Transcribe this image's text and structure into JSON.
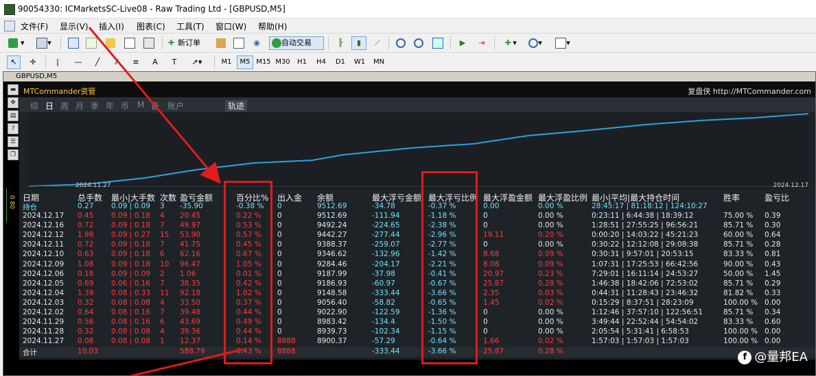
{
  "window": {
    "title": "90054330: ICMarketsSC-Live08 - Raw Trading Ltd - [GBPUSD,M5]"
  },
  "menu": [
    "文件(F)",
    "显示(V)",
    "插入(I)",
    "图表(C)",
    "工具(T)",
    "窗口(W)",
    "帮助(H)"
  ],
  "toolbar": {
    "new_order": "新订单",
    "autotrade": "自动交易",
    "timeframes": [
      "M1",
      "M5",
      "M15",
      "M30",
      "H1",
      "H4",
      "D1",
      "W1",
      "MN"
    ],
    "active_timeframe": "M5"
  },
  "chart_window": {
    "title": "GBPUSD,M5",
    "side_price": "0 80"
  },
  "panel": {
    "brand": "MTCommander资管",
    "brand_right_label": "复盘侠",
    "brand_right_url": "http://MTCommander.com",
    "tabs": [
      "综",
      "日",
      "周",
      "月",
      "季",
      "年",
      "币",
      "M",
      "备",
      "账户"
    ],
    "active_tab": "日",
    "track_tab": "轨迹",
    "graph_date_start": "2024.11.27",
    "graph_date_end": "2024.12.17"
  },
  "table": {
    "headers": [
      "日期",
      "总手数",
      "最小|大手数",
      "次数",
      "盈亏金额",
      "百分比%",
      "出入金",
      "余额",
      "最大浮亏金额",
      "最大浮亏比例",
      "最大浮盈金额",
      "最大浮盈比例",
      "最小|平均|最大持仓时间",
      "胜率",
      "盈亏比"
    ],
    "holding": [
      "持仓",
      "0.27",
      "0.09 | 0.09",
      "3",
      "-35.90",
      "-0.38 %",
      "0",
      "9512.69",
      "-34.78",
      "-0.37 %",
      "0.00",
      "0.00 %",
      "28:45:17 | 81:18:12 | 124:10:27",
      "",
      ""
    ],
    "rows": [
      [
        "2024.12.17",
        "0.45",
        "0.09 | 0.18",
        "4",
        "20.45",
        "0.22 %",
        "0",
        "9512.69",
        "-111.94",
        "-1.18 %",
        "0",
        "0.00 %",
        "0:23:11 | 6:44:38 | 18:39:12",
        "75.00 %",
        "0.39"
      ],
      [
        "2024.12.16",
        "0.72",
        "0.09 | 0.18",
        "7",
        "49.97",
        "0.53 %",
        "0",
        "9492.24",
        "-224.65",
        "-2.38 %",
        "0",
        "0.00 %",
        "1:28:51 | 27:55:25 | 96:56:21",
        "85.71 %",
        "0.30"
      ],
      [
        "2024.12.12",
        "1.98",
        "0.09 | 0.27",
        "15",
        "53.90",
        "0.57 %",
        "0",
        "9442.27",
        "-277.44",
        "-2.96 %",
        "19.11",
        "0.20 %",
        "0:00:20 | 14:03:22 | 45:21:23",
        "60.00 %",
        "0.64"
      ],
      [
        "2024.12.11",
        "0.72",
        "0.09 | 0.18",
        "7",
        "41.75",
        "0.45 %",
        "0",
        "9388.37",
        "-259.07",
        "-2.77 %",
        "0",
        "0.00 %",
        "0:30:22 | 12:12:08 | 29:08:38",
        "85.71 %",
        "0.28"
      ],
      [
        "2024.12.10",
        "0.63",
        "0.09 | 0.18",
        "6",
        "62.16",
        "0.67 %",
        "0",
        "9346.62",
        "-132.96",
        "-1.42 %",
        "8.68",
        "0.09 %",
        "0:30:31 | 9:57:01 | 20:53:15",
        "83.33 %",
        "0.81"
      ],
      [
        "2024.12.09",
        "1.08",
        "0.09 | 0.18",
        "10",
        "96.47",
        "1.05 %",
        "0",
        "9284.46",
        "-204.17",
        "-2.21 %",
        "8.08",
        "0.09 %",
        "1:07:31 | 17:25:53 | 66:42:56",
        "90.00 %",
        "0.43"
      ],
      [
        "2024.12.06",
        "0.18",
        "0.09 | 0.09",
        "2",
        "1.06",
        "0.01 %",
        "0",
        "9187.99",
        "-37.98",
        "-0.41 %",
        "20.97",
        "0.23 %",
        "7:29:01 | 16:11:14 | 24:53:27",
        "50.00 %",
        "1.45"
      ],
      [
        "2024.12.05",
        "0.69",
        "0.06 | 0.16",
        "7",
        "38.35",
        "0.42 %",
        "0",
        "9186.93",
        "-60.97",
        "-0.67 %",
        "25.87",
        "0.28 %",
        "1:46:38 | 18:42:06 | 72:53:02",
        "85.71 %",
        "0.29"
      ],
      [
        "2024.12.04",
        "1.39",
        "0.08 | 0.33",
        "11",
        "92.18",
        "1.02 %",
        "0",
        "9148.58",
        "-333.44",
        "-3.66 %",
        "2.35",
        "0.03 %",
        "0:44:31 | 11:28:43 | 23:46:32",
        "81.82 %",
        "0.33"
      ],
      [
        "2024.12.03",
        "0.32",
        "0.08 | 0.08",
        "4",
        "33.50",
        "0.37 %",
        "0",
        "9056.40",
        "-58.82",
        "-0.65 %",
        "1.45",
        "0.02 %",
        "0:15:29 | 8:37:51 | 28:23:09",
        "100.00 %",
        "0.00"
      ],
      [
        "2024.12.02",
        "0.64",
        "0.08 | 0.16",
        "7",
        "39.48",
        "0.44 %",
        "0",
        "9022.90",
        "-122.59",
        "-1.36 %",
        "0",
        "0.00 %",
        "1:12:46 | 37:57:10 | 122:56:51",
        "85.71 %",
        "0.34"
      ],
      [
        "2024.11.29",
        "0.56",
        "0.08 | 0.16",
        "6",
        "43.69",
        "0.49 %",
        "0",
        "8983.42",
        "-134.4",
        "-1.50 %",
        "0",
        "0.00 %",
        "3:49:44 | 22:52:44 | 54:54:02",
        "83.33 %",
        "0.60"
      ],
      [
        "2024.11.28",
        "0.32",
        "0.08 | 0.08",
        "4",
        "39.36",
        "0.44 %",
        "0",
        "8939.73",
        "-102.34",
        "-1.15 %",
        "0",
        "0.00 %",
        "2:05:54 | 5:31:41 | 6:58:53",
        "100.00 %",
        "0.00"
      ],
      [
        "2024.11.27",
        "0.08",
        "0.08 | 0.08",
        "1",
        "12.37",
        "0.14 %",
        "8888",
        "8900.37",
        "-57.29",
        "-0.64 %",
        "1.66",
        "0.02 %",
        "1:57:03 | 1:57:03 | 1:57:03",
        "100.00 %",
        "0.00"
      ]
    ],
    "totals": [
      "合计",
      "10.03",
      "",
      "",
      "588.79",
      "6.43 %",
      "8888",
      "",
      "-333.44",
      "-3.66 %",
      "25.87",
      "0.28 %",
      "",
      "",
      ""
    ]
  },
  "watermark": {
    "icon": "f",
    "text": "@量邦EA"
  }
}
